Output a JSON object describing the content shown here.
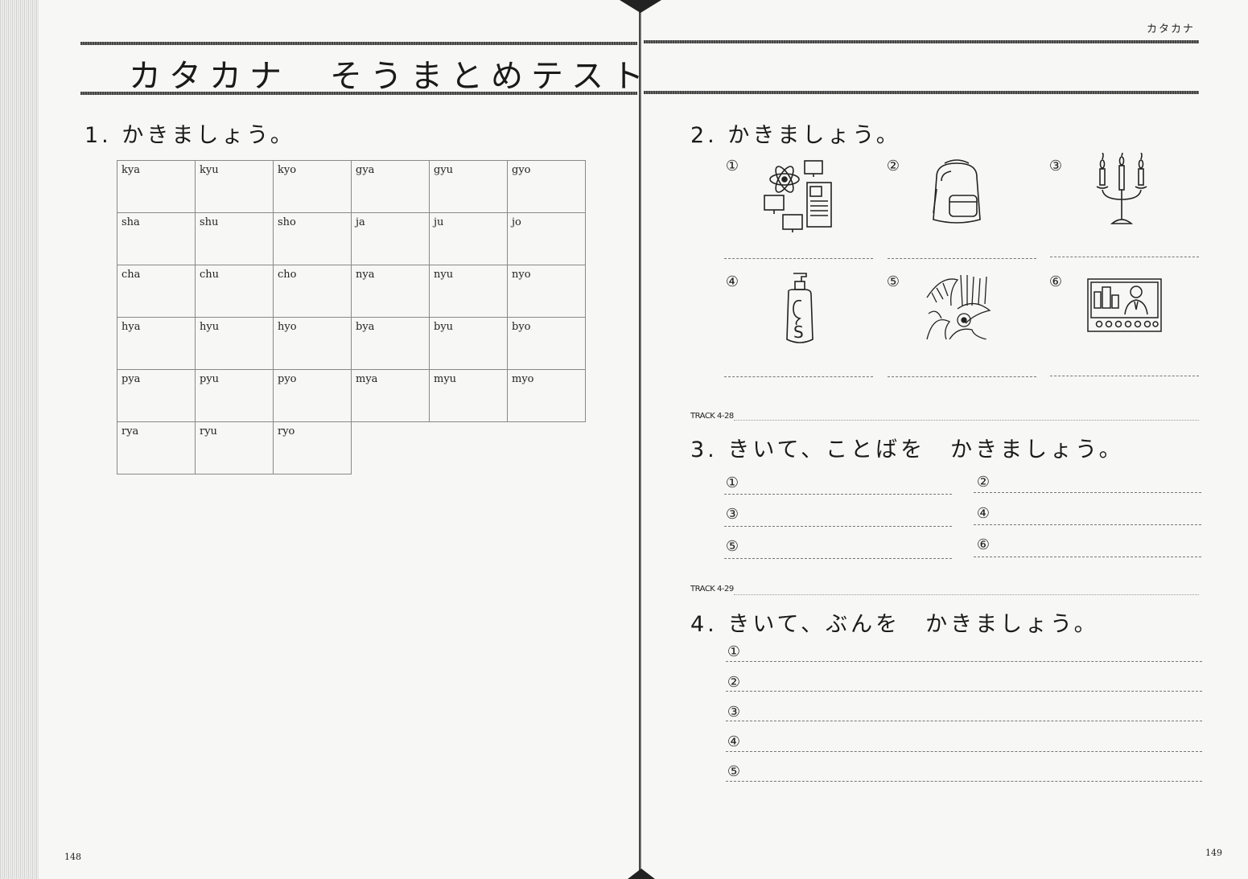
{
  "header": {
    "label": "カタカナ",
    "title": "カタカナ　そうまとめテスト"
  },
  "pages": {
    "left": "148",
    "right": "149"
  },
  "section1": {
    "heading": "1. かきましょう。",
    "grid": [
      [
        "kya",
        "kyu",
        "kyo",
        "gya",
        "gyu",
        "gyo"
      ],
      [
        "sha",
        "shu",
        "sho",
        "ja",
        "ju",
        "jo"
      ],
      [
        "cha",
        "chu",
        "cho",
        "nya",
        "nyu",
        "nyo"
      ],
      [
        "hya",
        "hyu",
        "hyo",
        "bya",
        "byu",
        "byo"
      ],
      [
        "pya",
        "pyu",
        "pyo",
        "mya",
        "myu",
        "myo"
      ],
      [
        "rya",
        "ryu",
        "ryo",
        "",
        "",
        ""
      ]
    ]
  },
  "section2": {
    "heading": "2. かきましょう。",
    "items": [
      {
        "num": "①",
        "icon": "computers-icon"
      },
      {
        "num": "②",
        "icon": "backpack-icon"
      },
      {
        "num": "③",
        "icon": "candelabra-icon"
      },
      {
        "num": "④",
        "icon": "shampoo-bottle-icon"
      },
      {
        "num": "⑤",
        "icon": "jungle-icon"
      },
      {
        "num": "⑥",
        "icon": "news-tv-icon"
      }
    ]
  },
  "section3": {
    "track": "TRACK 4-28",
    "heading": "3. きいて、ことばを　かきましょう。",
    "items": [
      "①",
      "②",
      "③",
      "④",
      "⑤",
      "⑥"
    ]
  },
  "section4": {
    "track": "TRACK 4-29",
    "heading": "4. きいて、ぶんを　かきましょう。",
    "items": [
      "①",
      "②",
      "③",
      "④",
      "⑤"
    ]
  }
}
